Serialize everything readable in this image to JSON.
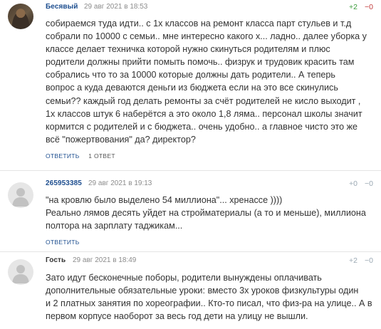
{
  "comments": [
    {
      "author": "Бесявый",
      "date": "29 авг 2021 в 18:53",
      "votes_plus": "+2",
      "votes_minus": "−0",
      "text": "собираемся туда идти.. с 1х классов на ремонт класса парт стульев и т.д\nсобрали по 10000 с семьи.. мне интересно какого х... ладно.. далее уборка у\nклассе делает техничка которой нужно скинуться родителям и плюс\nродители должны прийти помыть помочь.. физрук и трудовик красить там\nсобрались что то за 10000 которые должны дать родители.. А теперь\nвопрос а куда деваются деньги из бюджета если на это все скинулись\nсемьи?? каждый год делать ремонты за счёт родителей не кисло выходит ,\n1х классов штук 6 наберётся а это около 1,8 ляма.. персонал школы значит\nкормится с родителей и с бюджета.. очень удобно.. а главное чисто это же\nвсё \"пожертвования\" да? директор?",
      "reply_label": "ответить",
      "replies_label": "1 ответ",
      "avatar_icon": "user-photo-avatar"
    },
    {
      "author": "265953385",
      "date": "29 авг 2021 в 19:13",
      "votes_plus": "+0",
      "votes_minus": "−0",
      "text": "\"на кровлю было выделено 54 миллиона\"... хренассе ))))\nРеально лямов десять уйдет на стройматериалы (а то и меньше), миллиона\nполтора на зарплату таджикам...",
      "reply_label": "ответить",
      "avatar_icon": "default-user-icon"
    },
    {
      "author": "Гость",
      "date": "29 авг 2021 в 18:49",
      "votes_plus": "+2",
      "votes_minus": "−0",
      "text": "Зато идут бесконечные поборы, родители вынуждены оплачивать\nдополнительные обязательные уроки: вместо 3х уроков физкультуры один\nи 2 платных занятия по хореографии.. Кто-то писал, что физ-ра на улице.. А в\nпервом корпусе наоборот за весь год дети на улицу не вышли.",
      "avatar_icon": "default-user-icon"
    }
  ],
  "colors": {
    "author_link": "#1d4e8f",
    "vote_plus": "#3a9c3a",
    "vote_minus": "#c23b3b",
    "vote_muted": "#9aa8b3",
    "date": "#8c8c8c"
  }
}
